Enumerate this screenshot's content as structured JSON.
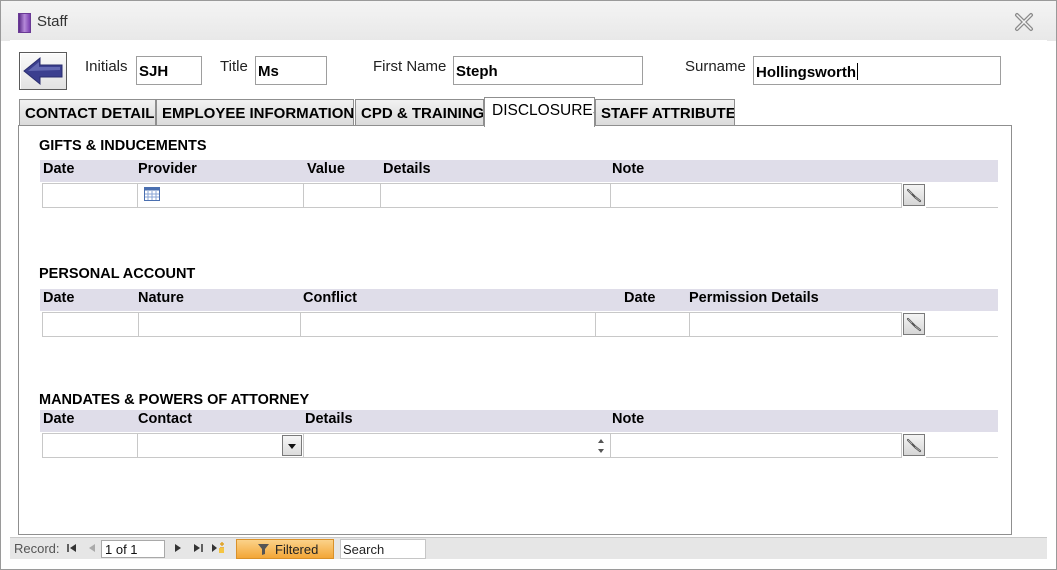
{
  "window": {
    "title": "Staff"
  },
  "header": {
    "initials_label": "Initials",
    "initials_value": "SJH",
    "title_label": "Title",
    "title_value": "Ms",
    "first_name_label": "First Name",
    "first_name_value": "Steph",
    "surname_label": "Surname",
    "surname_value": "Hollingsworth"
  },
  "tabs": [
    {
      "label": "CONTACT DETAILS"
    },
    {
      "label": "EMPLOYEE INFORMATION"
    },
    {
      "label": "CPD & TRAINING"
    },
    {
      "label": "DISCLOSURES",
      "active": true
    },
    {
      "label": "STAFF ATTRIBUTES"
    }
  ],
  "gifts": {
    "title": "GIFTS & INDUCEMENTS",
    "columns": [
      "Date",
      "Provider",
      "Value",
      "Details",
      "Note"
    ]
  },
  "personal": {
    "title": "PERSONAL ACCOUNT",
    "columns": [
      "Date",
      "Nature",
      "Conflict",
      "Date",
      "Permission Details"
    ]
  },
  "mandates": {
    "title": "MANDATES & POWERS OF ATTORNEY",
    "columns": [
      "Date",
      "Contact",
      "Details",
      "Note"
    ]
  },
  "statusbar": {
    "record_label": "Record:",
    "record_value": "1 of 1",
    "filter_label": "Filtered",
    "search_label": "Search"
  },
  "colors": {
    "header_bar": "#dfdde9",
    "filter_bg": "#f3a637",
    "back_arrow": "#3b3f8f"
  }
}
